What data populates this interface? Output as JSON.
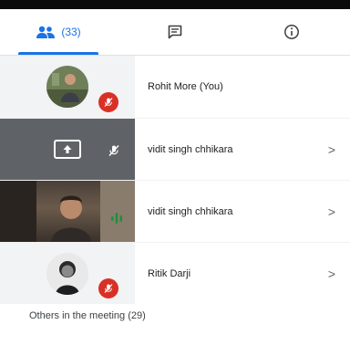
{
  "tabs": [
    {
      "name": "people",
      "icon": "people-icon",
      "count": "(33)",
      "active": true
    },
    {
      "name": "chat",
      "icon": "chat-icon",
      "active": false
    },
    {
      "name": "info",
      "icon": "info-icon",
      "active": false
    }
  ],
  "participants": [
    {
      "name": "Rohit More (You)",
      "muted": true,
      "tile": "avatar-photo"
    },
    {
      "name": "vidit singh chhikara",
      "muted": true,
      "tile": "presenting-screen"
    },
    {
      "name": "vidit singh chhikara",
      "muted": false,
      "speaking": true,
      "tile": "camera-video"
    },
    {
      "name": "Ritik Darji",
      "muted": true,
      "tile": "avatar-photo"
    }
  ],
  "others_label": "Others in the meeting (29)",
  "colors": {
    "accent": "#1a73e8",
    "muted_badge": "#d93025",
    "speaking": "#1e8e3e"
  }
}
